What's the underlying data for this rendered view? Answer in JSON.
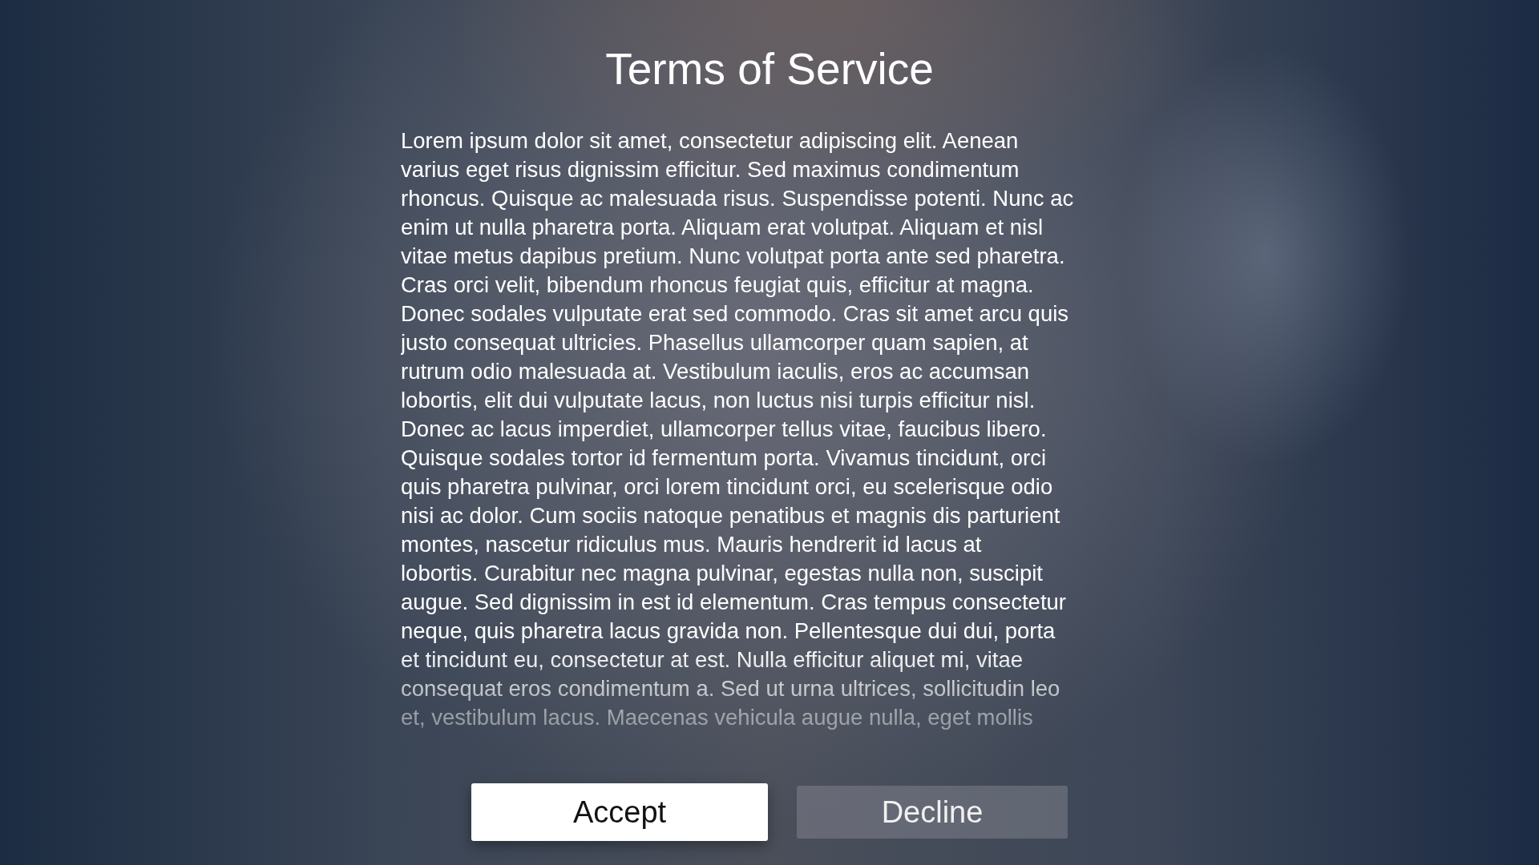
{
  "title": "Terms of Service",
  "body_lines": [
    "Lorem ipsum dolor sit amet, consectetur adipiscing elit. Aenean",
    "varius eget risus dignissim efficitur. Sed maximus condimentum",
    "rhoncus. Quisque ac malesuada risus. Suspendisse potenti. Nunc ac",
    "enim ut nulla pharetra porta. Aliquam erat volutpat. Aliquam et nisl",
    "vitae metus dapibus pretium. Nunc volutpat porta ante sed pharetra.",
    "Cras orci velit, bibendum rhoncus feugiat quis, efficitur at magna.",
    "Donec sodales vulputate erat sed commodo. Cras sit amet arcu quis",
    "justo consequat ultricies. Phasellus ullamcorper quam sapien, at",
    "rutrum odio malesuada at. Vestibulum iaculis, eros ac accumsan",
    "lobortis, elit dui vulputate lacus, non luctus nisi turpis efficitur nisl.",
    "Donec ac lacus imperdiet, ullamcorper tellus vitae, faucibus libero.",
    "Quisque sodales tortor id fermentum porta. Vivamus tincidunt, orci",
    "quis pharetra pulvinar, orci lorem tincidunt orci, eu scelerisque odio",
    "nisi ac dolor. Cum sociis natoque penatibus et magnis dis parturient",
    "montes, nascetur ridiculus mus. Mauris hendrerit id lacus at",
    "lobortis. Curabitur nec magna pulvinar, egestas nulla non, suscipit",
    "augue. Sed dignissim in est id elementum. Cras tempus consectetur",
    "neque, quis pharetra lacus gravida non. Pellentesque dui dui, porta",
    "et tincidunt eu, consectetur at est. Nulla efficitur aliquet mi, vitae",
    "consequat eros condimentum a. Sed ut urna ultrices, sollicitudin leo",
    "et, vestibulum lacus. Maecenas vehicula augue nulla, eget mollis"
  ],
  "buttons": [
    {
      "label": "Accept",
      "selected": true
    },
    {
      "label": "Decline",
      "selected": false
    }
  ]
}
